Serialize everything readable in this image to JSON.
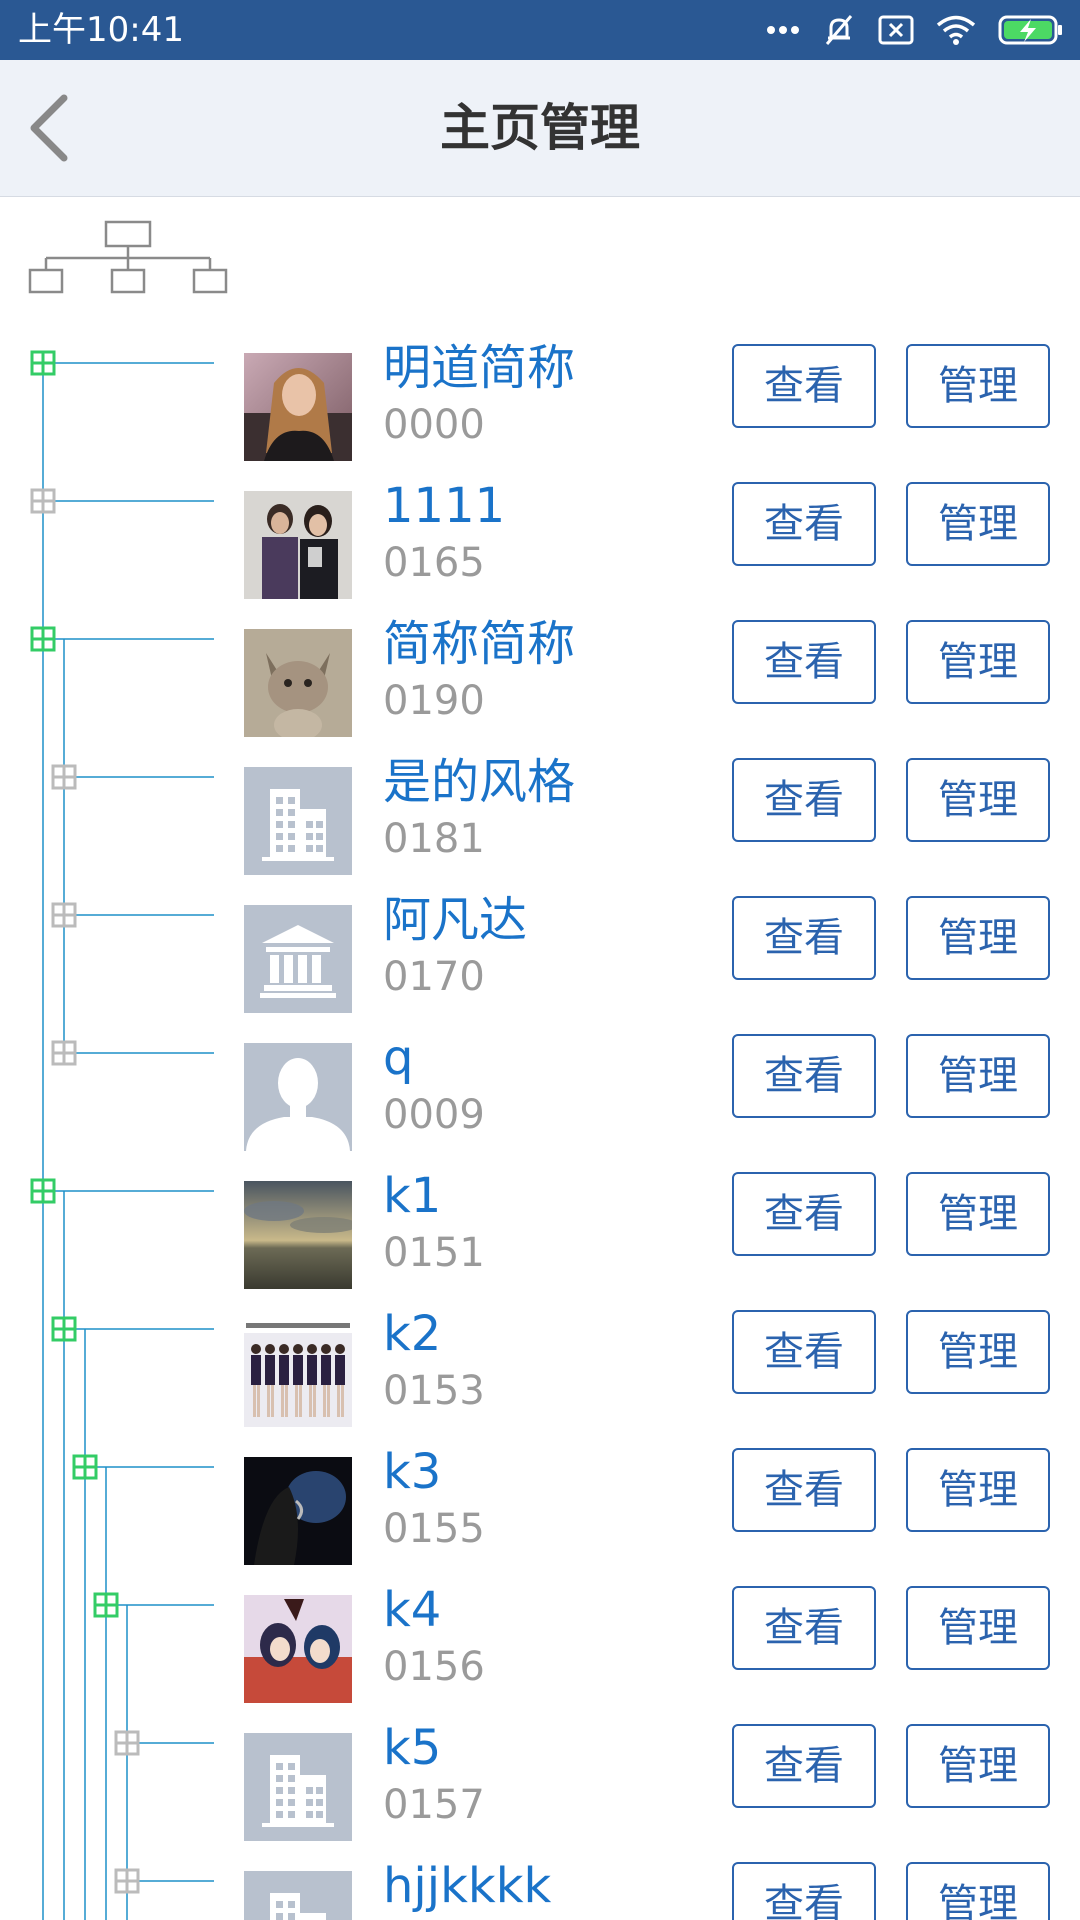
{
  "status_bar": {
    "time": "上午10:41",
    "icons": [
      "more-dots-icon",
      "mute-bell-icon",
      "sim-x-icon",
      "wifi-icon",
      "battery-charging-icon"
    ],
    "background_color": "#2a5893"
  },
  "nav": {
    "title": "主页管理",
    "back_icon": "chevron-left-icon"
  },
  "colors": {
    "name_text": "#1a73c9",
    "code_text": "#9a9a9a",
    "button_border": "#2b63ae",
    "tree_line": "#1e90c8",
    "expander_expanded": "#33cc66",
    "expander_collapsed": "#bbbbbb"
  },
  "tree_icon": "org-chart-icon",
  "buttons": {
    "view": "查看",
    "manage": "管理"
  },
  "items": [
    {
      "name": "明道简称",
      "code": "0000",
      "avatar": "photo-woman",
      "level": 0,
      "expanded": true
    },
    {
      "name": "1111",
      "code": "0165",
      "avatar": "photo-couple",
      "level": 0,
      "expanded": false
    },
    {
      "name": "简称简称",
      "code": "0190",
      "avatar": "photo-cat",
      "level": 0,
      "expanded": true
    },
    {
      "name": "是的风格",
      "code": "0181",
      "avatar": "building-icon",
      "level": 1,
      "expanded": false
    },
    {
      "name": "阿凡达",
      "code": "0170",
      "avatar": "institution-icon",
      "level": 1,
      "expanded": false
    },
    {
      "name": "q",
      "code": "0009",
      "avatar": "person-silhouette-icon",
      "level": 1,
      "expanded": false
    },
    {
      "name": "k1",
      "code": "0151",
      "avatar": "photo-sunset-sea",
      "level": 0,
      "expanded": true
    },
    {
      "name": "k2",
      "code": "0153",
      "avatar": "photo-girls-generation",
      "level": 1,
      "expanded": true
    },
    {
      "name": "k3",
      "code": "0155",
      "avatar": "photo-dark-fantasy",
      "level": 2,
      "expanded": true
    },
    {
      "name": "k4",
      "code": "0156",
      "avatar": "photo-anime",
      "level": 3,
      "expanded": true
    },
    {
      "name": "k5",
      "code": "0157",
      "avatar": "building-icon",
      "level": 4,
      "expanded": false
    },
    {
      "name": "hjjkkkk",
      "code": "",
      "avatar": "building-icon",
      "level": 4,
      "expanded": false
    }
  ]
}
